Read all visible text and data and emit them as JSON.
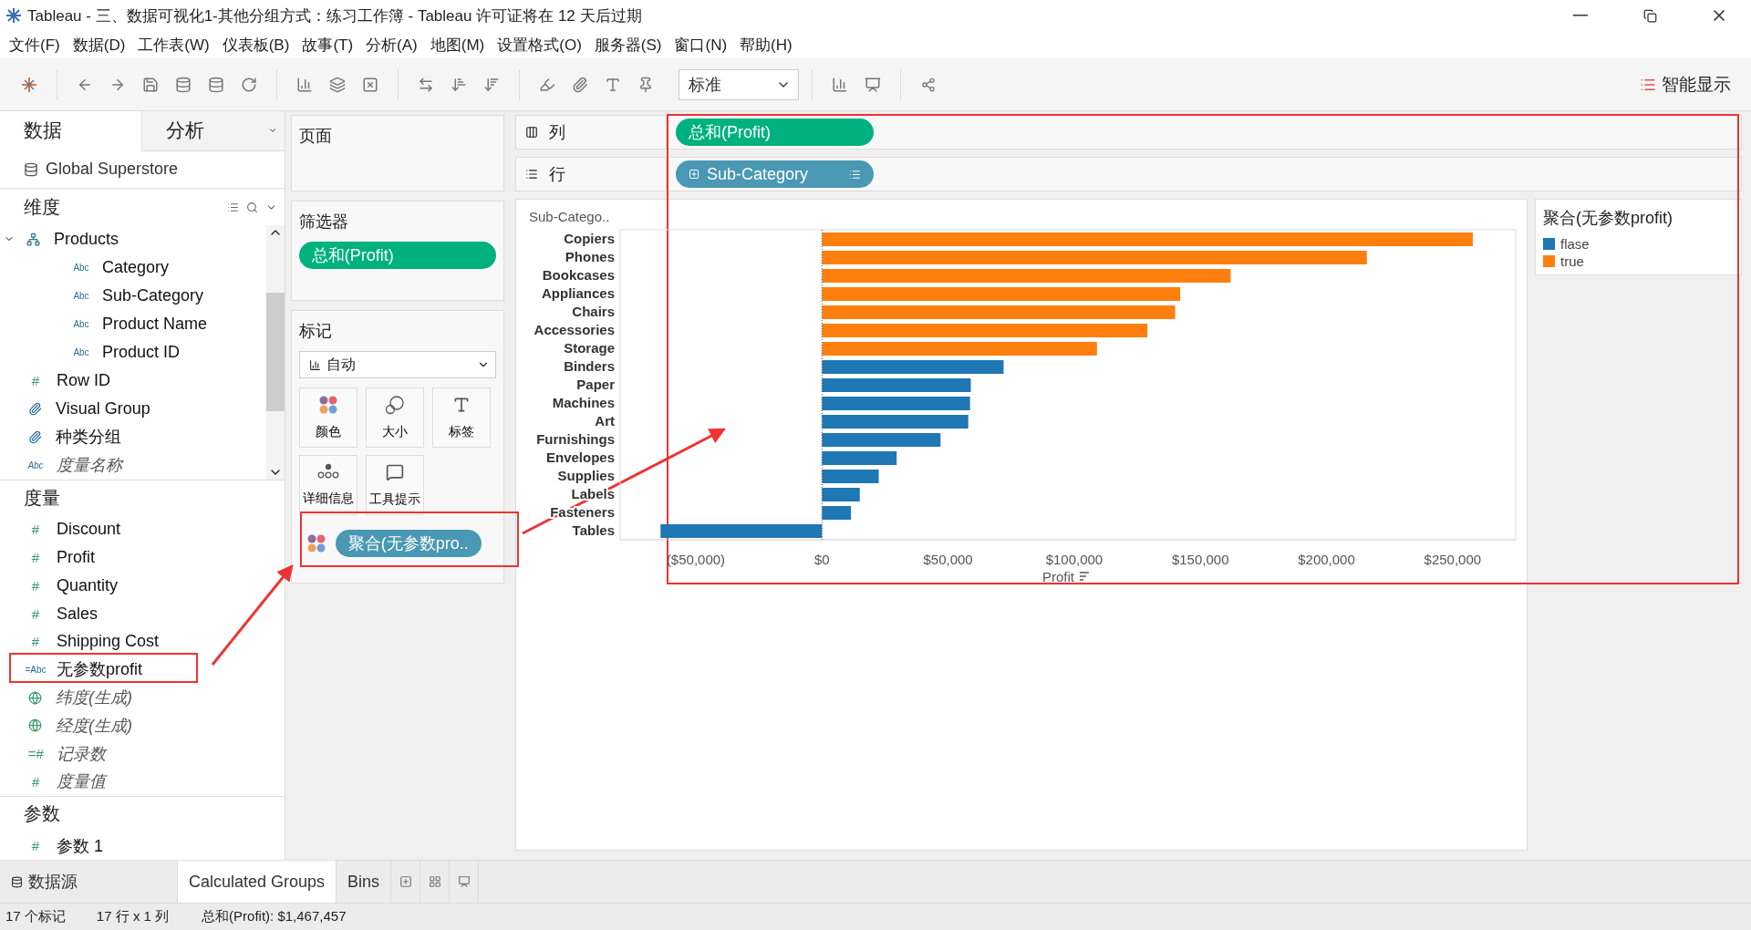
{
  "window": {
    "title": "Tableau - 三、数据可视化1-其他分组方式：练习工作簿 - Tableau 许可证将在 12 天后过期"
  },
  "menu": [
    "文件(F)",
    "数据(D)",
    "工作表(W)",
    "仪表板(B)",
    "故事(T)",
    "分析(A)",
    "地图(M)",
    "设置格式(O)",
    "服务器(S)",
    "窗口(N)",
    "帮助(H)"
  ],
  "toolbar": {
    "view_size": "标准",
    "show_me": "智能显示"
  },
  "side_tabs": [
    {
      "label": "数据",
      "selected": true
    },
    {
      "label": "分析",
      "selected": false
    }
  ],
  "data_source": "Global Superstore",
  "dimensions": {
    "title": "维度",
    "items": [
      {
        "label": "Products",
        "kind": "hierarchy",
        "expanded": true,
        "children": [
          {
            "label": "Category",
            "kind": "glyph",
            "glyph": "Abc"
          },
          {
            "label": "Sub-Category",
            "kind": "glyph",
            "glyph": "Abc"
          },
          {
            "label": "Product Name",
            "kind": "glyph",
            "glyph": "Abc"
          },
          {
            "label": "Product ID",
            "kind": "glyph",
            "glyph": "Abc"
          }
        ]
      },
      {
        "label": "Row ID",
        "kind": "glyph",
        "glyph": "#"
      },
      {
        "label": "Visual Group",
        "kind": "group"
      },
      {
        "label": "种类分组",
        "kind": "group"
      },
      {
        "label": "度量名称",
        "kind": "glyph",
        "glyph": "Abc",
        "generated": true
      }
    ]
  },
  "measures": {
    "title": "度量",
    "items": [
      {
        "label": "Discount",
        "kind": "glyph",
        "glyph": "#"
      },
      {
        "label": "Profit",
        "kind": "glyph",
        "glyph": "#"
      },
      {
        "label": "Quantity",
        "kind": "glyph",
        "glyph": "#"
      },
      {
        "label": "Sales",
        "kind": "glyph",
        "glyph": "#"
      },
      {
        "label": "Shipping Cost",
        "kind": "glyph",
        "glyph": "#"
      },
      {
        "label": "无参数profit",
        "kind": "glyph",
        "glyph": "=Abc"
      },
      {
        "label": "纬度(生成)",
        "kind": "geo",
        "generated": true
      },
      {
        "label": "经度(生成)",
        "kind": "geo",
        "generated": true
      },
      {
        "label": "记录数",
        "kind": "glyph",
        "glyph": "=#",
        "generated": true
      },
      {
        "label": "度量值",
        "kind": "glyph",
        "glyph": "#",
        "generated": true
      }
    ]
  },
  "parameters": {
    "title": "参数",
    "items": [
      {
        "label": "参数 1",
        "kind": "glyph",
        "glyph": "#"
      }
    ]
  },
  "pages_card": {
    "title": "页面"
  },
  "filters_card": {
    "title": "筛选器",
    "pills": [
      "总和(Profit)"
    ]
  },
  "marks_card": {
    "title": "标记",
    "mark_type": "自动",
    "buttons": [
      {
        "label": "颜色",
        "kind": "color"
      },
      {
        "label": "大小",
        "kind": "size"
      },
      {
        "label": "标签",
        "kind": "label"
      },
      {
        "label": "详细信息",
        "kind": "detail"
      },
      {
        "label": "工具提示",
        "kind": "tooltip"
      }
    ],
    "pills": [
      {
        "label": "聚合(无参数pro..",
        "kind": "color"
      }
    ]
  },
  "columns_shelf": {
    "label": "列",
    "pills": [
      {
        "label": "总和(Profit)",
        "kind": "measure"
      }
    ]
  },
  "rows_shelf": {
    "label": "行",
    "pills": [
      {
        "label": "Sub-Category",
        "kind": "dimension"
      }
    ]
  },
  "chart": {
    "row_header": "Sub-Catego..",
    "chart_data": {
      "type": "bar",
      "orientation": "horizontal",
      "xlabel": "Profit",
      "categories": [
        "Copiers",
        "Phones",
        "Bookcases",
        "Appliances",
        "Chairs",
        "Accessories",
        "Storage",
        "Binders",
        "Paper",
        "Machines",
        "Art",
        "Furnishings",
        "Envelopes",
        "Supplies",
        "Labels",
        "Fasteners",
        "Tables"
      ],
      "series": [
        {
          "name": "flase",
          "color": "#1f77b4",
          "values": [
            null,
            null,
            null,
            null,
            null,
            null,
            null,
            72000,
            59000,
            58700,
            58000,
            47000,
            29600,
            22500,
            15000,
            11500,
            -64000
          ]
        },
        {
          "name": "true",
          "color": "#ff7f0e",
          "values": [
            258000,
            216000,
            162000,
            142000,
            140000,
            129000,
            109000,
            null,
            null,
            null,
            null,
            null,
            null,
            null,
            null,
            null,
            null
          ]
        }
      ],
      "stacked": true,
      "xlim": [
        -80000,
        275000
      ],
      "xticks": [
        {
          "value": -50000,
          "label": "($50,000)"
        },
        {
          "value": 0,
          "label": "$0"
        },
        {
          "value": 50000,
          "label": "$50,000"
        },
        {
          "value": 100000,
          "label": "$100,000"
        },
        {
          "value": 150000,
          "label": "$150,000"
        },
        {
          "value": 200000,
          "label": "$200,000"
        },
        {
          "value": 250000,
          "label": "$250,000"
        }
      ]
    }
  },
  "legend": {
    "title": "聚合(无参数profit)"
  },
  "sheet_tabs": [
    {
      "label": "数据源",
      "kind": "datasource",
      "selected": false
    },
    {
      "label": "Calculated Groups",
      "kind": "sheet",
      "selected": true
    },
    {
      "label": "Bins",
      "kind": "sheet",
      "selected": false
    }
  ],
  "status_bar": [
    "17 个标记",
    "17 行 x 1 列",
    "总和(Profit): $1,467,457"
  ]
}
